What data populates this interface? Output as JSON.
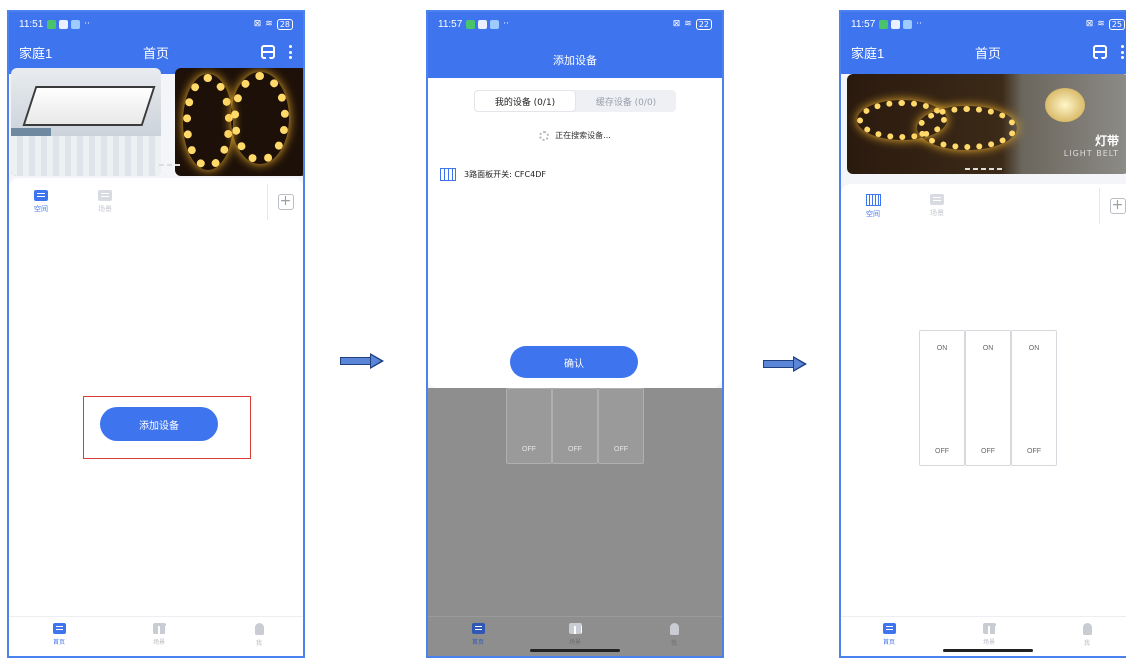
{
  "status": {
    "time_1": "11:51",
    "time_2": "11:57",
    "time_3": "11:57",
    "battery_1": "28",
    "battery_2": "22",
    "battery_3": "25"
  },
  "header": {
    "home_name": "家庭1",
    "title": "首页"
  },
  "tabs": {
    "space": "空间",
    "scene": "场景"
  },
  "add_device_button": "添加设备",
  "dialog": {
    "title": "添加设备",
    "seg_my_devices": "我的设备 (0/1)",
    "seg_cached_devices": "缓存设备 (0/0)",
    "searching": "正在搜索设备...",
    "device_name": "3路面板开关: CFC4DF",
    "confirm": "确认"
  },
  "banner": {
    "light_belt_cn": "灯带",
    "light_belt_en": "LIGHT BELT"
  },
  "switch": {
    "on": "ON",
    "off": "OFF"
  },
  "bottom_nav": {
    "home": "首页",
    "scene": "场景",
    "me": "我"
  },
  "colors": {
    "primary": "#3f74ef",
    "highlight": "#d93a3a"
  }
}
